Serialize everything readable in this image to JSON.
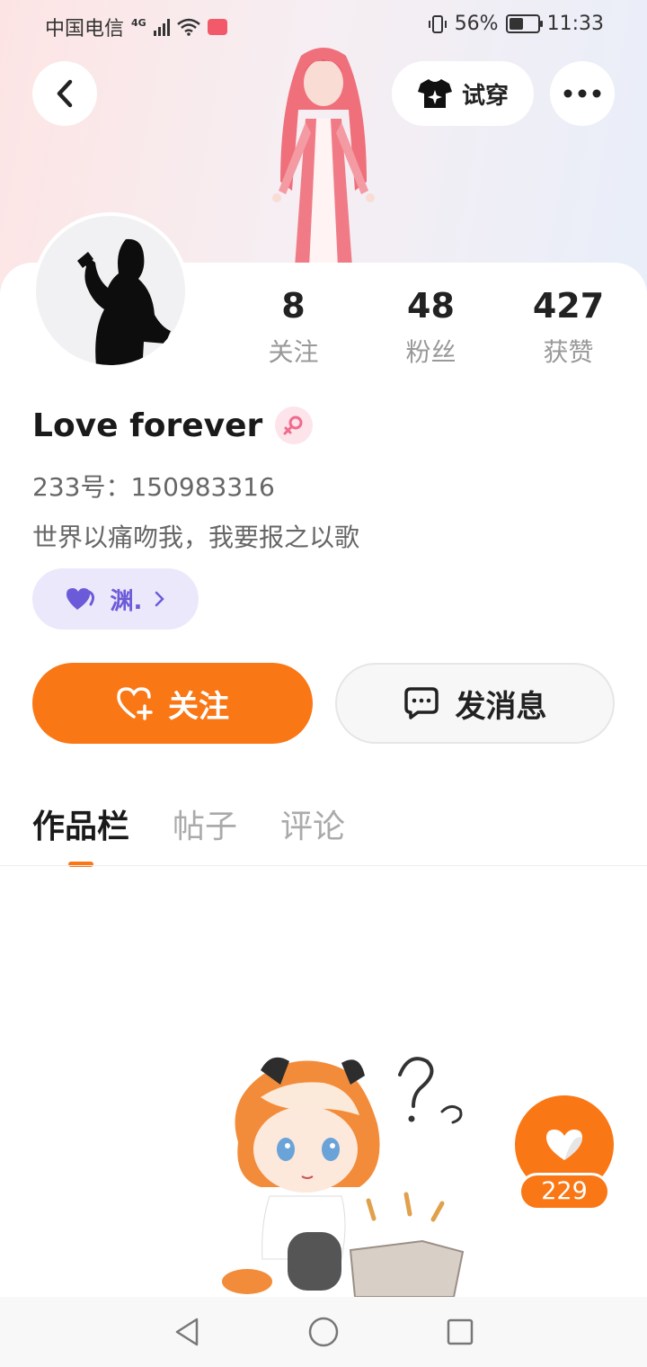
{
  "status_bar": {
    "carrier": "中国电信",
    "network": "4G",
    "battery": "56%",
    "battery_level": 0.56,
    "time": "11:33"
  },
  "header": {
    "back_icon": "chevron-left-icon",
    "tryon_label": "试穿",
    "more_icon": "more-dots-icon"
  },
  "profile": {
    "stats": [
      {
        "value": "8",
        "label": "关注"
      },
      {
        "value": "48",
        "label": "粉丝"
      },
      {
        "value": "427",
        "label": "获赞"
      }
    ],
    "name": "Love forever",
    "gender_icon": "female-icon",
    "uid": "233号：150983316",
    "bio": "世界以痛吻我，我要报之以歌",
    "tag_label": "渊."
  },
  "actions": {
    "follow_label": "关注",
    "message_label": "发消息"
  },
  "tabs": [
    {
      "label": "作品栏",
      "active": true
    },
    {
      "label": "帖子",
      "active": false
    },
    {
      "label": "评论",
      "active": false
    }
  ],
  "like_float": {
    "count": "229"
  },
  "colors": {
    "accent": "#fa7716",
    "tag_text": "#6c5bd8",
    "tag_bg": "#ebe8fb"
  }
}
